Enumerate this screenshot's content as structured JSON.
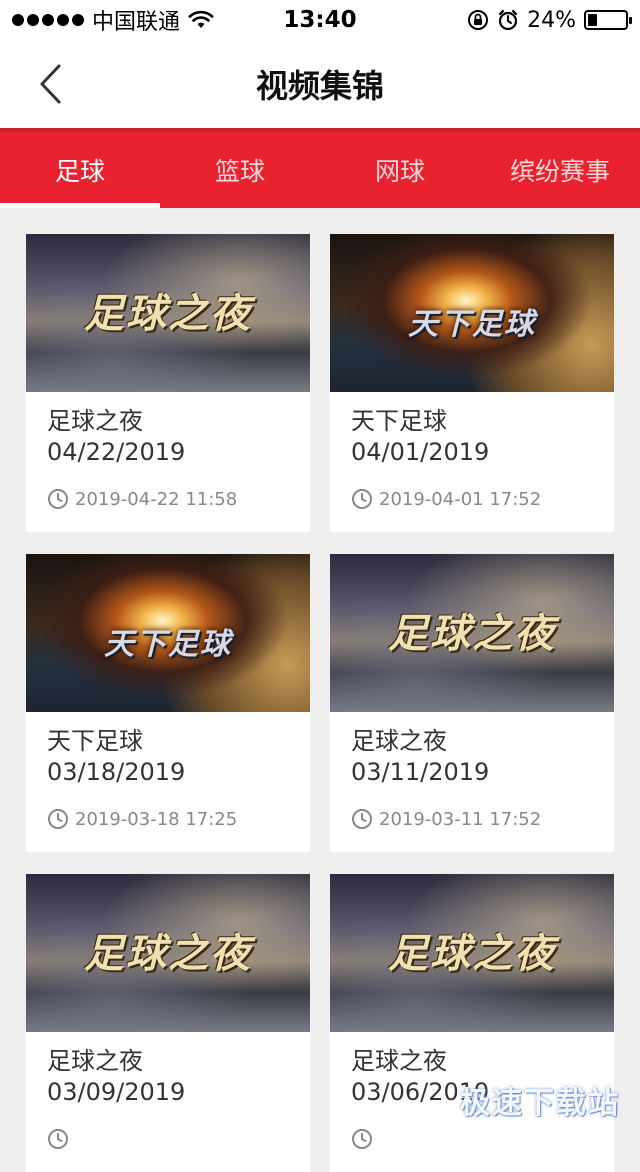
{
  "status_bar": {
    "carrier": "中国联通",
    "time": "13:40",
    "battery_percent": "24%",
    "battery_level": 0.24
  },
  "nav": {
    "title": "视频集锦",
    "back_icon": "chevron-left-icon"
  },
  "tabs": [
    {
      "label": "足球",
      "active": true
    },
    {
      "label": "篮球",
      "active": false
    },
    {
      "label": "网球",
      "active": false
    },
    {
      "label": "缤纷赛事",
      "active": false
    }
  ],
  "videos": [
    {
      "title": "足球之夜",
      "date": "04/22/2019",
      "time": "2019-04-22 11:58",
      "thumb_text": "足球之夜"
    },
    {
      "title": "天下足球",
      "date": "04/01/2019",
      "time": "2019-04-01 17:52",
      "thumb_text": "天下足球"
    },
    {
      "title": "天下足球",
      "date": "03/18/2019",
      "time": "2019-03-18 17:25",
      "thumb_text": "天下足球"
    },
    {
      "title": "足球之夜",
      "date": "03/11/2019",
      "time": "2019-03-11 17:52",
      "thumb_text": "足球之夜"
    },
    {
      "title": "足球之夜",
      "date": "03/09/2019",
      "time": "",
      "thumb_text": "足球之夜"
    },
    {
      "title": "足球之夜",
      "date": "03/06/2019",
      "time": "",
      "thumb_text": "足球之夜"
    }
  ],
  "watermark": "极速下载站",
  "colors": {
    "accent": "#e8232f",
    "background": "#efefef"
  }
}
